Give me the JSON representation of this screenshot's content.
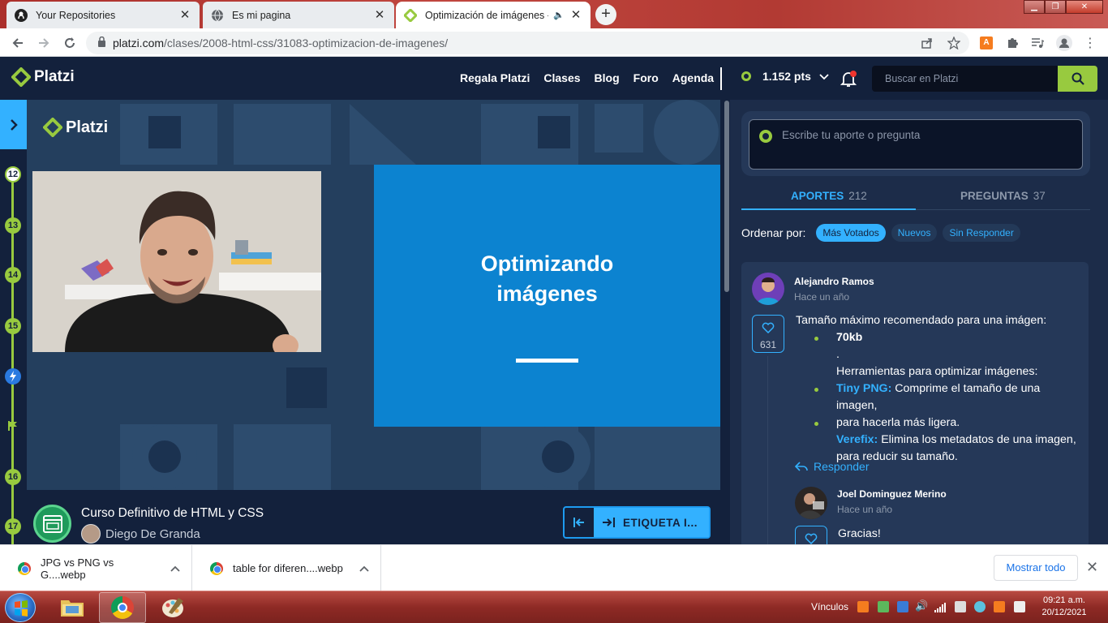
{
  "browser": {
    "tabs": [
      {
        "title": "Your Repositories",
        "icon": "github-icon"
      },
      {
        "title": "Es mi pagina",
        "icon": "globe-icon"
      },
      {
        "title": "Optimización de imágenes -",
        "icon": "platzi-icon",
        "audio": true
      }
    ],
    "url_domain": "platzi.com",
    "url_path": "/clases/2008-html-css/31083-optimizacion-de-imagenes/"
  },
  "header": {
    "brand": "Platzi",
    "nav": [
      "Regala Platzi",
      "Clases",
      "Blog",
      "Foro",
      "Agenda"
    ],
    "points": "1.152 pts",
    "search_placeholder": "Buscar en Platzi"
  },
  "rail": {
    "numbers": [
      "12",
      "13",
      "14",
      "15",
      "16",
      "17"
    ],
    "current": "12"
  },
  "video": {
    "brand": "Platzi",
    "slide_title_line1": "Optimizando",
    "slide_title_line2": "imágenes"
  },
  "course": {
    "title": "Curso Definitivo de HTML y CSS",
    "author": "Diego De Granda",
    "next_label": "ETIQUETA I..."
  },
  "panel": {
    "ask_placeholder": "Escribe tu aporte o pregunta",
    "tab_aportes": "APORTES",
    "tab_aportes_count": "212",
    "tab_preguntas": "PREGUNTAS",
    "tab_preguntas_count": "37",
    "order_label": "Ordenar por:",
    "order_options": [
      "Más Votados",
      "Nuevos",
      "Sin Responder"
    ],
    "selected_order": "Más Votados"
  },
  "post": {
    "author": "Alejandro Ramos",
    "when": "Hace un año",
    "likes": "631",
    "intro": "Tamaño máximo recomendado para una imágen:",
    "size": "70kb",
    "dot": ".",
    "tools_heading": "Herramientas para optimizar imágenes:",
    "tool1_name": "Tiny PNG:",
    "tool1_desc_1": "Comprime el tamaño de una imagen,",
    "tool1_desc_2": "para hacerla más ligera.",
    "tool2_name": "Verefix:",
    "tool2_desc_1": "Elimina los metadatos de una imagen,",
    "tool2_desc_2": "para reducir su tamaño.",
    "reply_label": "Responder"
  },
  "reply": {
    "author": "Joel Dominguez Merino",
    "when": "Hace un año",
    "text": "Gracias!"
  },
  "downloads": {
    "items": [
      "JPG vs PNG vs G....webp",
      "table for diferen....webp"
    ],
    "show_all": "Mostrar todo"
  },
  "taskbar": {
    "tray_label": "Vínculos",
    "time": "09:21 a.m.",
    "date": "20/12/2021"
  },
  "colors": {
    "platzi_navy": "#13213c",
    "platzi_green": "#98ca3f",
    "platzi_blue": "#33b1ff",
    "slide_blue": "#0c83d0"
  }
}
